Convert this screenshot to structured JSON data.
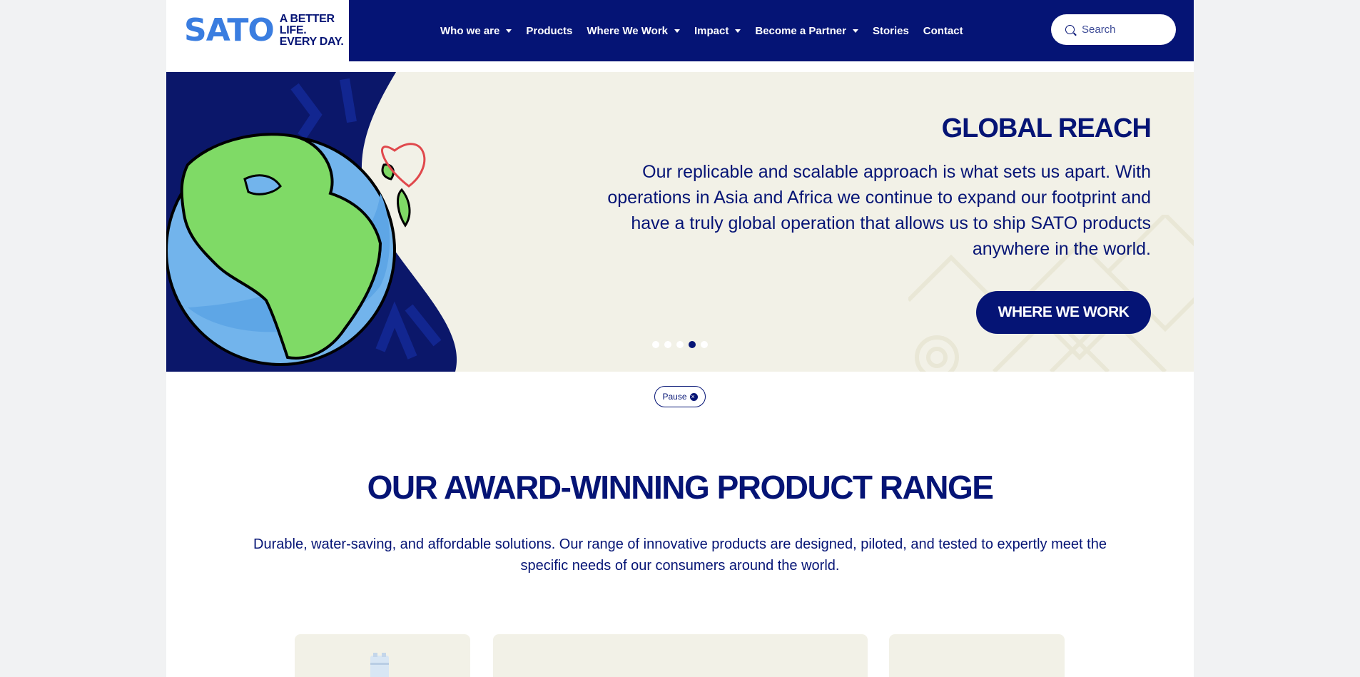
{
  "brand": {
    "logo_text": "SATO",
    "tagline_line1": "A BETTER LIFE.",
    "tagline_line2": "EVERY DAY."
  },
  "nav": {
    "items": [
      {
        "label": "Who we are",
        "has_dropdown": true
      },
      {
        "label": "Products",
        "has_dropdown": false
      },
      {
        "label": "Where We Work",
        "has_dropdown": true
      },
      {
        "label": "Impact",
        "has_dropdown": true
      },
      {
        "label": "Become a Partner",
        "has_dropdown": true
      },
      {
        "label": "Stories",
        "has_dropdown": false
      },
      {
        "label": "Contact",
        "has_dropdown": false
      }
    ]
  },
  "search": {
    "placeholder": "Search",
    "icon": "search-icon"
  },
  "hero": {
    "title": "GLOBAL REACH",
    "text": "Our replicable and scalable approach is what sets us apart. With operations in Asia and Africa we continue to expand our footprint and have a truly global operation that allows us to ship SATO products anywhere in the world.",
    "button_label": "WHERE WE WORK",
    "slide_count": 5,
    "active_slide": 4
  },
  "carousel": {
    "pause_label": "Pause"
  },
  "products_section": {
    "title": "OUR AWARD-WINNING PRODUCT RANGE",
    "text": "Durable, water-saving, and affordable solutions. Our range of innovative products are designed, piloted, and tested to expertly meet the specific needs of our consumers around the world."
  },
  "colors": {
    "navy": "#051475",
    "logo_blue": "#3a7de0",
    "hero_bg": "#f2f1e7",
    "page_bg": "#f1f2f3"
  }
}
